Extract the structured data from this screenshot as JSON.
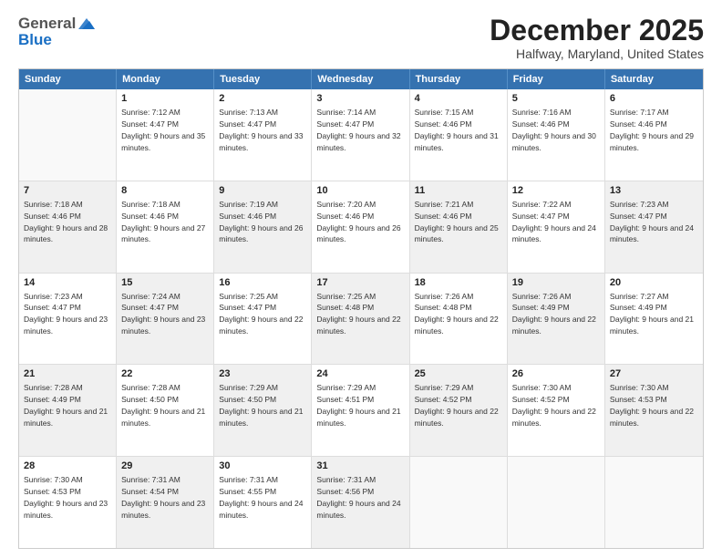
{
  "logo": {
    "general": "General",
    "blue": "Blue"
  },
  "title": "December 2025",
  "subtitle": "Halfway, Maryland, United States",
  "header_days": [
    "Sunday",
    "Monday",
    "Tuesday",
    "Wednesday",
    "Thursday",
    "Friday",
    "Saturday"
  ],
  "rows": [
    [
      {
        "day": "",
        "empty": true
      },
      {
        "day": "1",
        "sunrise": "Sunrise: 7:12 AM",
        "sunset": "Sunset: 4:47 PM",
        "daylight": "Daylight: 9 hours and 35 minutes."
      },
      {
        "day": "2",
        "sunrise": "Sunrise: 7:13 AM",
        "sunset": "Sunset: 4:47 PM",
        "daylight": "Daylight: 9 hours and 33 minutes."
      },
      {
        "day": "3",
        "sunrise": "Sunrise: 7:14 AM",
        "sunset": "Sunset: 4:47 PM",
        "daylight": "Daylight: 9 hours and 32 minutes."
      },
      {
        "day": "4",
        "sunrise": "Sunrise: 7:15 AM",
        "sunset": "Sunset: 4:46 PM",
        "daylight": "Daylight: 9 hours and 31 minutes."
      },
      {
        "day": "5",
        "sunrise": "Sunrise: 7:16 AM",
        "sunset": "Sunset: 4:46 PM",
        "daylight": "Daylight: 9 hours and 30 minutes."
      },
      {
        "day": "6",
        "sunrise": "Sunrise: 7:17 AM",
        "sunset": "Sunset: 4:46 PM",
        "daylight": "Daylight: 9 hours and 29 minutes."
      }
    ],
    [
      {
        "day": "7",
        "sunrise": "Sunrise: 7:18 AM",
        "sunset": "Sunset: 4:46 PM",
        "daylight": "Daylight: 9 hours and 28 minutes.",
        "shaded": true
      },
      {
        "day": "8",
        "sunrise": "Sunrise: 7:18 AM",
        "sunset": "Sunset: 4:46 PM",
        "daylight": "Daylight: 9 hours and 27 minutes."
      },
      {
        "day": "9",
        "sunrise": "Sunrise: 7:19 AM",
        "sunset": "Sunset: 4:46 PM",
        "daylight": "Daylight: 9 hours and 26 minutes.",
        "shaded": true
      },
      {
        "day": "10",
        "sunrise": "Sunrise: 7:20 AM",
        "sunset": "Sunset: 4:46 PM",
        "daylight": "Daylight: 9 hours and 26 minutes."
      },
      {
        "day": "11",
        "sunrise": "Sunrise: 7:21 AM",
        "sunset": "Sunset: 4:46 PM",
        "daylight": "Daylight: 9 hours and 25 minutes.",
        "shaded": true
      },
      {
        "day": "12",
        "sunrise": "Sunrise: 7:22 AM",
        "sunset": "Sunset: 4:47 PM",
        "daylight": "Daylight: 9 hours and 24 minutes."
      },
      {
        "day": "13",
        "sunrise": "Sunrise: 7:23 AM",
        "sunset": "Sunset: 4:47 PM",
        "daylight": "Daylight: 9 hours and 24 minutes.",
        "shaded": true
      }
    ],
    [
      {
        "day": "14",
        "sunrise": "Sunrise: 7:23 AM",
        "sunset": "Sunset: 4:47 PM",
        "daylight": "Daylight: 9 hours and 23 minutes."
      },
      {
        "day": "15",
        "sunrise": "Sunrise: 7:24 AM",
        "sunset": "Sunset: 4:47 PM",
        "daylight": "Daylight: 9 hours and 23 minutes.",
        "shaded": true
      },
      {
        "day": "16",
        "sunrise": "Sunrise: 7:25 AM",
        "sunset": "Sunset: 4:47 PM",
        "daylight": "Daylight: 9 hours and 22 minutes."
      },
      {
        "day": "17",
        "sunrise": "Sunrise: 7:25 AM",
        "sunset": "Sunset: 4:48 PM",
        "daylight": "Daylight: 9 hours and 22 minutes.",
        "shaded": true
      },
      {
        "day": "18",
        "sunrise": "Sunrise: 7:26 AM",
        "sunset": "Sunset: 4:48 PM",
        "daylight": "Daylight: 9 hours and 22 minutes."
      },
      {
        "day": "19",
        "sunrise": "Sunrise: 7:26 AM",
        "sunset": "Sunset: 4:49 PM",
        "daylight": "Daylight: 9 hours and 22 minutes.",
        "shaded": true
      },
      {
        "day": "20",
        "sunrise": "Sunrise: 7:27 AM",
        "sunset": "Sunset: 4:49 PM",
        "daylight": "Daylight: 9 hours and 21 minutes."
      }
    ],
    [
      {
        "day": "21",
        "sunrise": "Sunrise: 7:28 AM",
        "sunset": "Sunset: 4:49 PM",
        "daylight": "Daylight: 9 hours and 21 minutes.",
        "shaded": true
      },
      {
        "day": "22",
        "sunrise": "Sunrise: 7:28 AM",
        "sunset": "Sunset: 4:50 PM",
        "daylight": "Daylight: 9 hours and 21 minutes."
      },
      {
        "day": "23",
        "sunrise": "Sunrise: 7:29 AM",
        "sunset": "Sunset: 4:50 PM",
        "daylight": "Daylight: 9 hours and 21 minutes.",
        "shaded": true
      },
      {
        "day": "24",
        "sunrise": "Sunrise: 7:29 AM",
        "sunset": "Sunset: 4:51 PM",
        "daylight": "Daylight: 9 hours and 21 minutes."
      },
      {
        "day": "25",
        "sunrise": "Sunrise: 7:29 AM",
        "sunset": "Sunset: 4:52 PM",
        "daylight": "Daylight: 9 hours and 22 minutes.",
        "shaded": true
      },
      {
        "day": "26",
        "sunrise": "Sunrise: 7:30 AM",
        "sunset": "Sunset: 4:52 PM",
        "daylight": "Daylight: 9 hours and 22 minutes."
      },
      {
        "day": "27",
        "sunrise": "Sunrise: 7:30 AM",
        "sunset": "Sunset: 4:53 PM",
        "daylight": "Daylight: 9 hours and 22 minutes.",
        "shaded": true
      }
    ],
    [
      {
        "day": "28",
        "sunrise": "Sunrise: 7:30 AM",
        "sunset": "Sunset: 4:53 PM",
        "daylight": "Daylight: 9 hours and 23 minutes."
      },
      {
        "day": "29",
        "sunrise": "Sunrise: 7:31 AM",
        "sunset": "Sunset: 4:54 PM",
        "daylight": "Daylight: 9 hours and 23 minutes.",
        "shaded": true
      },
      {
        "day": "30",
        "sunrise": "Sunrise: 7:31 AM",
        "sunset": "Sunset: 4:55 PM",
        "daylight": "Daylight: 9 hours and 24 minutes."
      },
      {
        "day": "31",
        "sunrise": "Sunrise: 7:31 AM",
        "sunset": "Sunset: 4:56 PM",
        "daylight": "Daylight: 9 hours and 24 minutes.",
        "shaded": true
      },
      {
        "day": "",
        "empty": true
      },
      {
        "day": "",
        "empty": true
      },
      {
        "day": "",
        "empty": true
      }
    ]
  ]
}
